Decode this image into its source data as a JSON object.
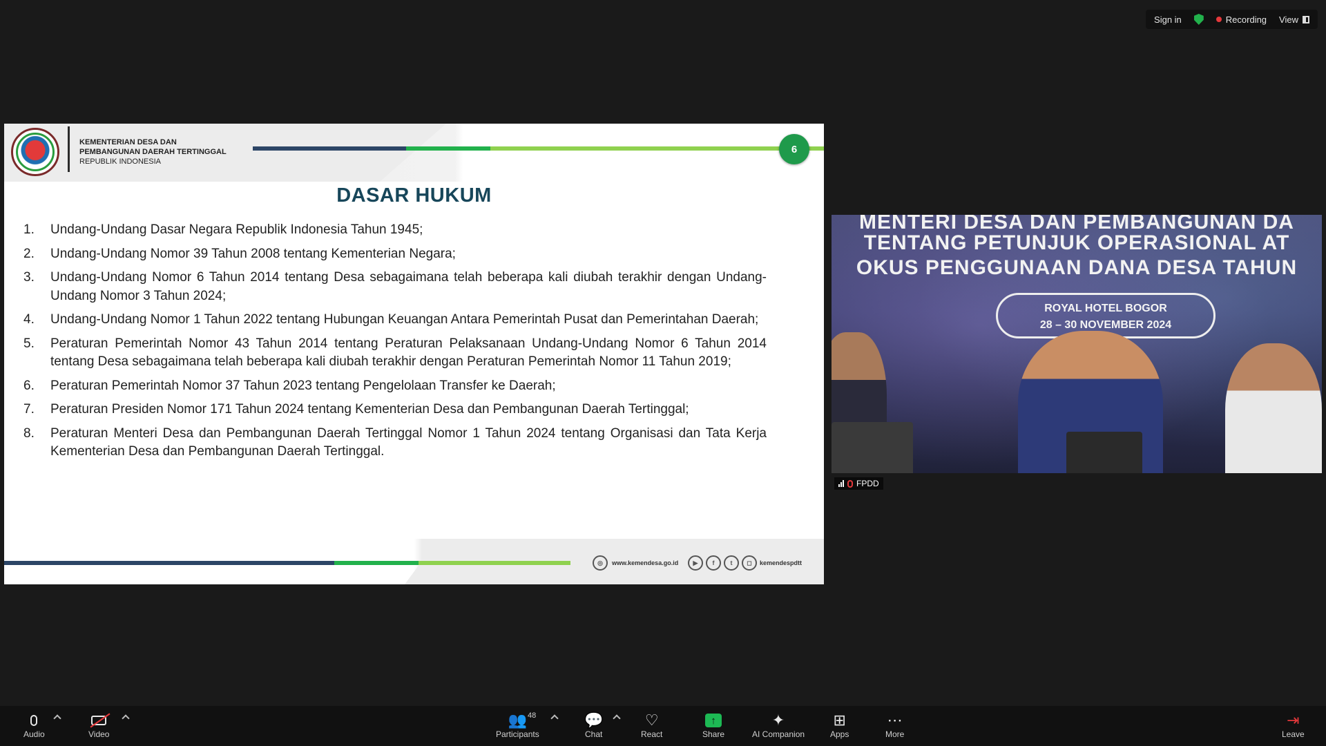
{
  "topbar": {
    "sign_in": "Sign in",
    "recording": "Recording",
    "view": "View",
    "colors": {
      "shield": "#22b14c",
      "recording_dot": "#e5383b"
    }
  },
  "slide": {
    "ministry_line1": "KEMENTERIAN DESA DAN",
    "ministry_line2": "PEMBANGUNAN DAERAH TERTINGGAL",
    "ministry_line3": "REPUBLIK INDONESIA",
    "page_number": "6",
    "title": "DASAR HUKUM",
    "items": [
      {
        "num": "1.",
        "text": "Undang-Undang Dasar Negara Republik Indonesia Tahun 1945;"
      },
      {
        "num": "2.",
        "text": "Undang-Undang Nomor 39 Tahun 2008 tentang Kementerian Negara;"
      },
      {
        "num": "3.",
        "text": "Undang-Undang Nomor 6 Tahun 2014 tentang Desa sebagaimana telah beberapa kali diubah terakhir dengan Undang-Undang Nomor 3 Tahun 2024;"
      },
      {
        "num": "4.",
        "text": "Undang-Undang Nomor 1 Tahun 2022 tentang Hubungan Keuangan Antara Pemerintah Pusat dan Pemerintahan Daerah;"
      },
      {
        "num": "5.",
        "text": "Peraturan Pemerintah Nomor 43 Tahun 2014 tentang Peraturan Pelaksanaan Undang-Undang Nomor 6 Tahun 2014 tentang Desa sebagaimana telah beberapa kali diubah terakhir dengan Peraturan Pemerintah Nomor 11 Tahun 2019;"
      },
      {
        "num": "6.",
        "text": "Peraturan Pemerintah Nomor 37 Tahun 2023 tentang Pengelolaan Transfer ke Daerah;"
      },
      {
        "num": "7.",
        "text": "Peraturan Presiden Nomor 171 Tahun 2024 tentang Kementerian Desa dan Pembangunan Daerah Tertinggal;"
      },
      {
        "num": "8.",
        "text": "Peraturan Menteri Desa dan Pembangunan Daerah Tertinggal Nomor 1 Tahun 2024 tentang Organisasi dan Tata Kerja Kementerian Desa dan Pembangunan Daerah Tertinggal."
      }
    ],
    "footer_website": "www.kemendesa.go.id",
    "footer_handle": "kemendespdtt",
    "colors": {
      "title": "#17465a",
      "navy": "#2c4566",
      "green": "#22b14c",
      "light_green": "#8fd14f",
      "badge": "#1f9a4b"
    }
  },
  "video": {
    "banner_line1": "MENTERI DESA DAN PEMBANGUNAN DA",
    "banner_line2": "TENTANG PETUNJUK OPERASIONAL AT",
    "banner_line3": "OKUS PENGGUNAAN DANA DESA TAHUN",
    "hotel_line1": "ROYAL HOTEL BOGOR",
    "hotel_line2": "28 – 30 NOVEMBER 2024",
    "participant_name": "FPDD"
  },
  "toolbar": {
    "audio": "Audio",
    "video": "Video",
    "participants": "Participants",
    "participants_count": "48",
    "chat": "Chat",
    "react": "React",
    "share": "Share",
    "ai_companion": "AI Companion",
    "apps": "Apps",
    "more": "More",
    "leave": "Leave",
    "colors": {
      "share": "#1db954",
      "leave_icon": "#e5383b"
    }
  }
}
